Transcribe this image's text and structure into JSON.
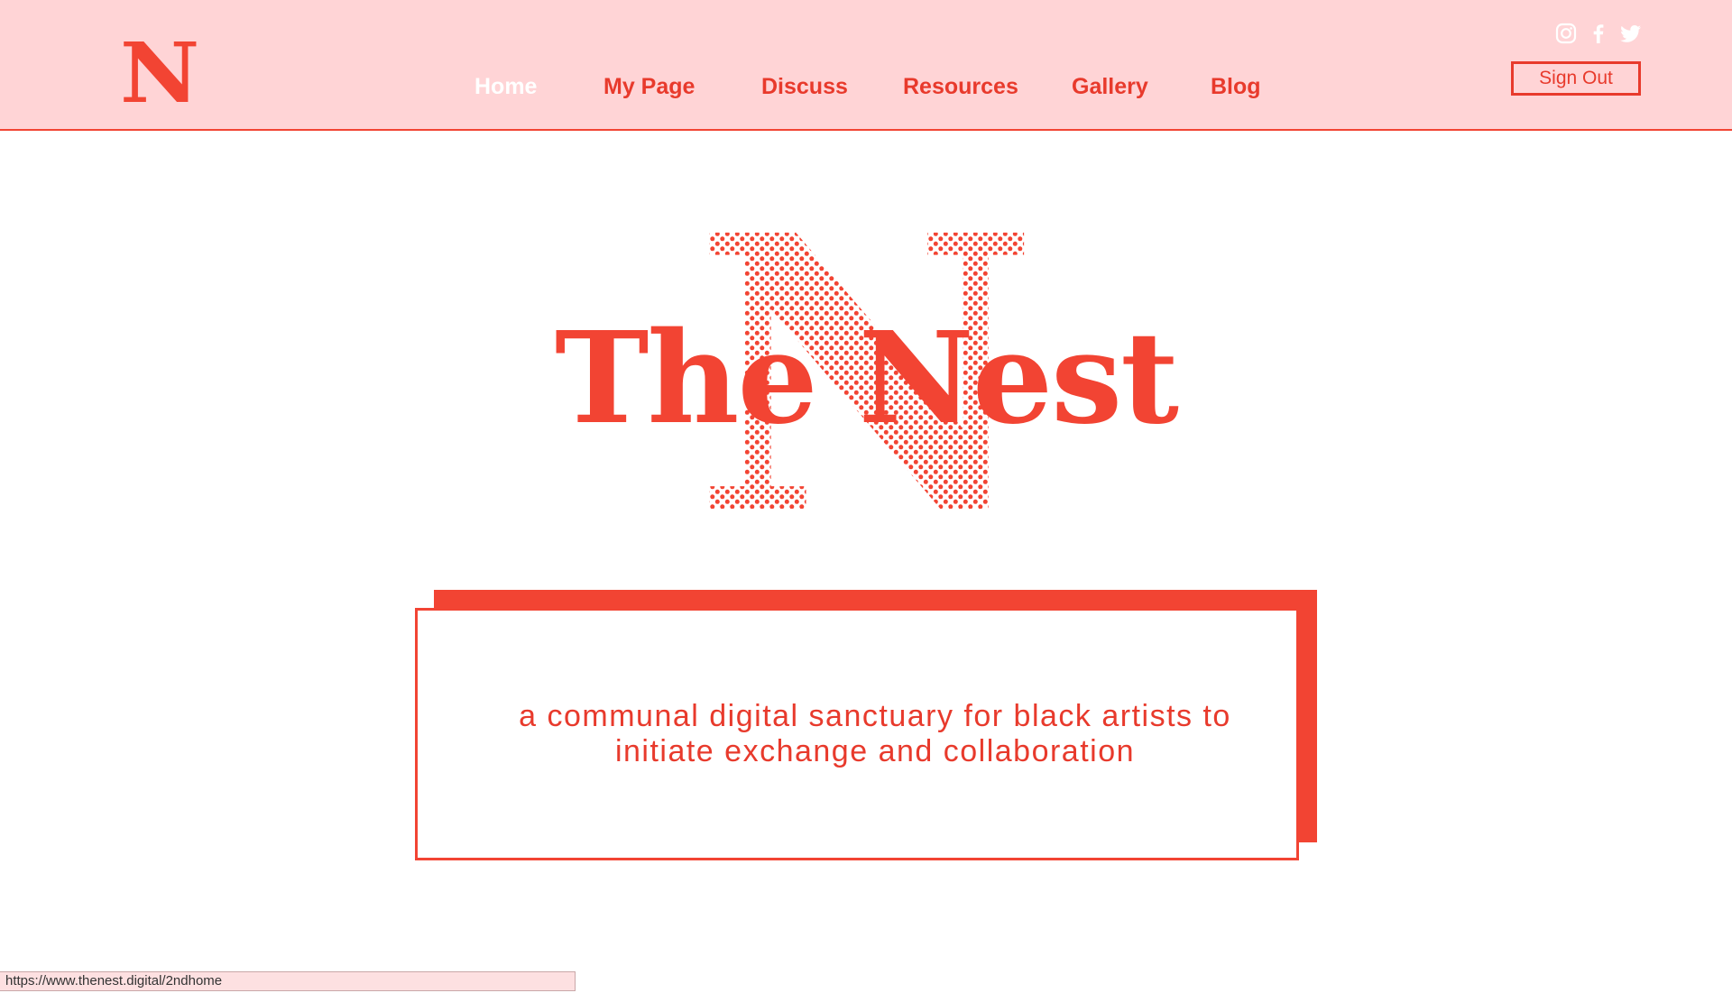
{
  "header": {
    "logo_letter": "N",
    "nav": [
      {
        "label": "Home",
        "active": true
      },
      {
        "label": "My Page",
        "active": false
      },
      {
        "label": "Discuss",
        "active": false
      },
      {
        "label": "Resources",
        "active": false
      },
      {
        "label": "Gallery",
        "active": false
      },
      {
        "label": "Blog",
        "active": false
      }
    ],
    "social_icons": [
      "instagram-icon",
      "facebook-icon",
      "twitter-icon"
    ],
    "sign_out_label": "Sign Out"
  },
  "hero": {
    "title": "The Nest",
    "big_letter": "N"
  },
  "tagline": {
    "line1": "a communal digital sanctuary for black artists to",
    "line2": "initiate exchange and collaboration"
  },
  "status_bar": {
    "url": "https://www.thenest.digital/2ndhome"
  },
  "colors": {
    "accent": "#f24433",
    "header_bg": "#ffd4d6",
    "nav_text": "#e83a2c",
    "nav_active": "#ffffff",
    "background": "#ffffff"
  }
}
